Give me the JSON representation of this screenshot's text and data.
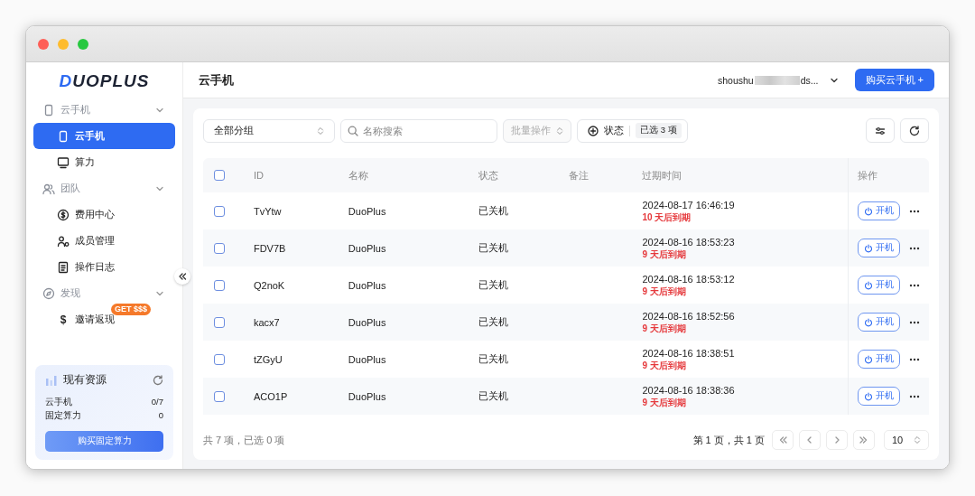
{
  "sidebar": {
    "logo": "DUOPLUS",
    "items": [
      {
        "kind": "group",
        "label": "云手机",
        "expanded": true,
        "children": [
          {
            "label": "云手机",
            "selected": true
          },
          {
            "label": "算力",
            "selected": false
          }
        ]
      },
      {
        "kind": "group",
        "label": "团队",
        "expanded": true,
        "children": [
          {
            "label": "费用中心",
            "selected": false
          },
          {
            "label": "成员管理",
            "selected": false
          },
          {
            "label": "操作日志",
            "selected": false
          }
        ]
      },
      {
        "kind": "group",
        "label": "发现",
        "expanded": true,
        "children": [
          {
            "icon_text": "$",
            "label": "邀请返现",
            "badge": "GET $$$",
            "selected": false
          }
        ]
      }
    ],
    "resources": {
      "title": "现有资源",
      "rows": [
        {
          "label": "云手机",
          "value": "0/7"
        },
        {
          "label": "固定算力",
          "value": "0"
        }
      ],
      "button": "购买固定算力"
    }
  },
  "header": {
    "title": "云手机",
    "user_start": "shoushu",
    "user_end": "ds...",
    "buy_button": "购买云手机 +"
  },
  "toolbar": {
    "group_select": "全部分组",
    "search_placeholder": "名称搜索",
    "batch": {
      "label": "批量操作",
      "disabled": true
    },
    "status_filter": {
      "label": "状态",
      "tag": "已选 3 项"
    }
  },
  "table": {
    "columns": [
      "ID",
      "名称",
      "状态",
      "备注",
      "过期时间",
      "操作"
    ],
    "all_checked": false,
    "rows": [
      {
        "checked": false,
        "id": "TvYtw",
        "name": "DuoPlus",
        "status": "已关机",
        "expiry": "2024-08-17 16:46:19",
        "remaining": "10 天后到期",
        "action": "开机"
      },
      {
        "checked": false,
        "id": "FDV7B",
        "name": "DuoPlus",
        "status": "已关机",
        "expiry": "2024-08-16 18:53:23",
        "remaining": "9 天后到期",
        "action": "开机"
      },
      {
        "checked": false,
        "id": "Q2noK",
        "name": "DuoPlus",
        "status": "已关机",
        "expiry": "2024-08-16 18:53:12",
        "remaining": "9 天后到期",
        "action": "开机"
      },
      {
        "checked": false,
        "id": "kacx7",
        "name": "DuoPlus",
        "status": "已关机",
        "expiry": "2024-08-16 18:52:56",
        "remaining": "9 天后到期",
        "action": "开机"
      },
      {
        "checked": false,
        "id": "tZGyU",
        "name": "DuoPlus",
        "status": "已关机",
        "expiry": "2024-08-16 18:38:51",
        "remaining": "9 天后到期",
        "action": "开机"
      },
      {
        "checked": false,
        "id": "ACO1P",
        "name": "DuoPlus",
        "status": "已关机",
        "expiry": "2024-08-16 18:38:36",
        "remaining": "9 天后到期",
        "action": "开机"
      }
    ]
  },
  "footer": {
    "summary": "共 7 项，已选 0 项",
    "page_info": "第 1 页，共 1 页",
    "page_size": "10"
  }
}
